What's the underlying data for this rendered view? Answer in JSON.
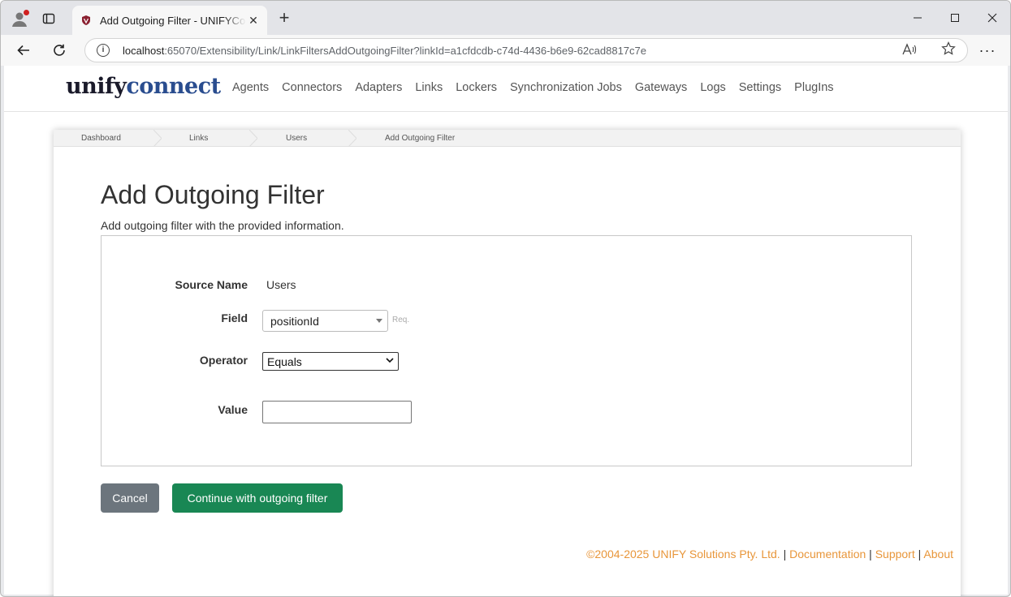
{
  "browser": {
    "tab_title": "Add Outgoing Filter - UNIFYConnect",
    "url_host": "localhost",
    "url_path": ":65070/Extensibility/Link/LinkFiltersAddOutgoingFilter?linkId=a1cfdcdb-c74d-4436-b6e9-62cad8817c7e",
    "read_aloud_label": "A̅",
    "new_tab_label": "+",
    "menu_label": "···"
  },
  "logo": {
    "part1": "unify",
    "part2": "connect"
  },
  "nav": [
    "Agents",
    "Connectors",
    "Adapters",
    "Links",
    "Lockers",
    "Synchronization Jobs",
    "Gateways",
    "Logs",
    "Settings",
    "PlugIns"
  ],
  "breadcrumb": [
    "Dashboard",
    "Links",
    "Users",
    "Add Outgoing Filter"
  ],
  "page": {
    "title": "Add Outgoing Filter",
    "subtitle": "Add outgoing filter with the provided information."
  },
  "form": {
    "source_name_label": "Source Name",
    "source_name_value": "Users",
    "field_label": "Field",
    "field_value": "positionId",
    "field_req": "Req.",
    "operator_label": "Operator",
    "operator_value": "Equals",
    "value_label": "Value",
    "value_value": ""
  },
  "buttons": {
    "cancel": "Cancel",
    "continue": "Continue with outgoing filter"
  },
  "footer": {
    "copyright": "©2004-2025 UNIFY Solutions Pty. Ltd.",
    "sep": " | ",
    "documentation": "Documentation",
    "support": "Support",
    "about": "About"
  },
  "colors": {
    "primary_button": "#198754",
    "secondary_button": "#6c757d",
    "footer_link": "#e8963a",
    "logo_connect": "#2a4d8f"
  }
}
